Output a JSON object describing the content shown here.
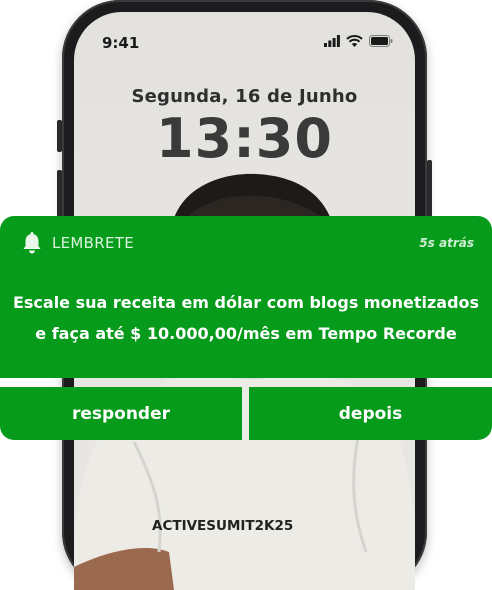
{
  "status_bar": {
    "time": "9:41"
  },
  "lock_screen": {
    "date": "Segunda, 16 de Junho",
    "time": "13:30"
  },
  "shirt_text": "ACTIVESUMIT2K25",
  "notification": {
    "app_name": "LEMBRETE",
    "timestamp": "5s atrás",
    "message_line1": "Escale sua receita em dólar com blogs monetizados",
    "message_line2": "e faça até $ 10.000,00/mês em Tempo Recorde",
    "reply_label": "responder",
    "later_label": "depois"
  },
  "colors": {
    "accent": "#079b1c"
  }
}
